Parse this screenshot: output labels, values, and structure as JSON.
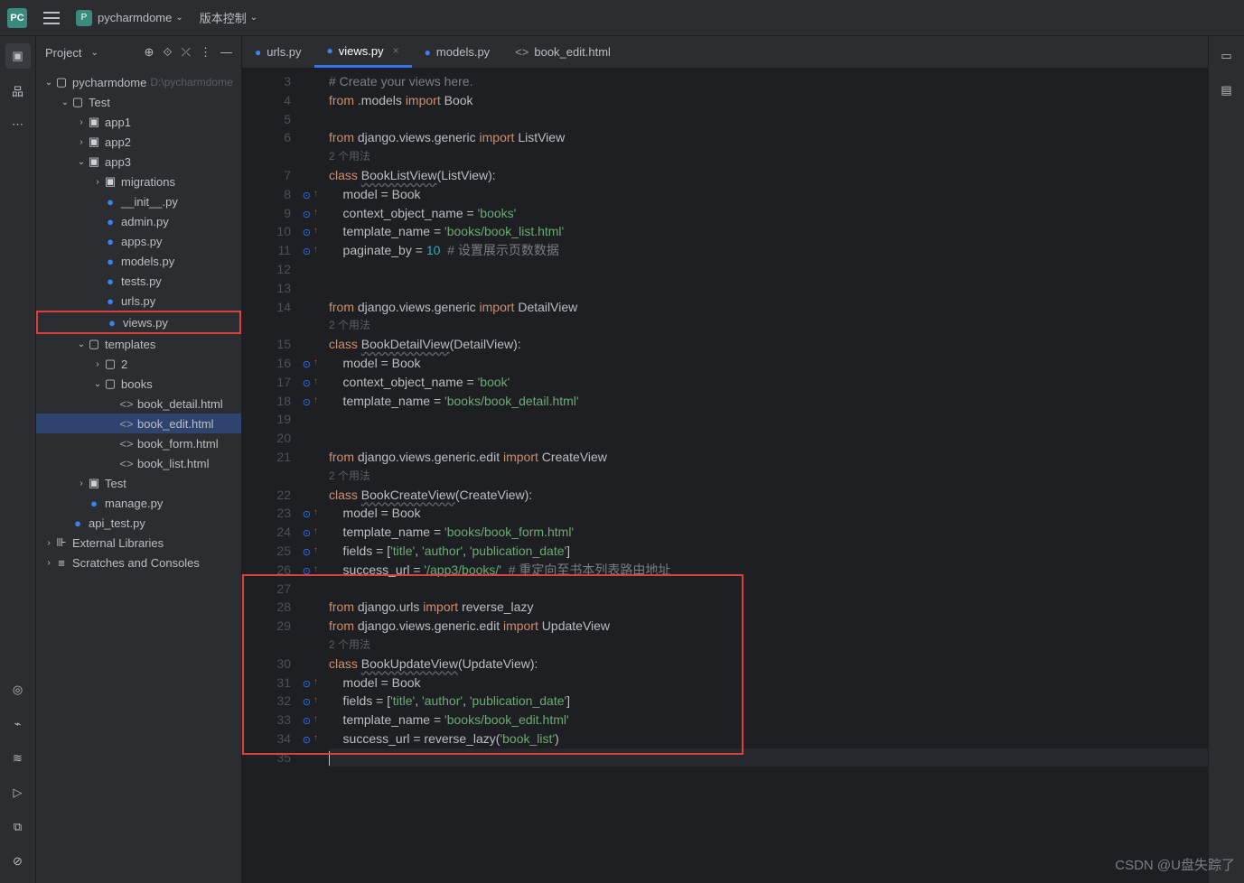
{
  "topbar": {
    "projectName": "pycharmdome",
    "vcs": "版本控制"
  },
  "projectPanel": {
    "title": "Project"
  },
  "tree": {
    "root": {
      "name": "pycharmdome",
      "path": "D:\\pycharmdome"
    },
    "test": "Test",
    "apps": [
      "app1",
      "app2",
      "app3"
    ],
    "app3": {
      "migrations": "migrations",
      "files": [
        "__init__.py",
        "admin.py",
        "apps.py",
        "models.py",
        "tests.py",
        "urls.py",
        "views.py"
      ]
    },
    "templates": "templates",
    "two": "2",
    "books": "books",
    "bookFiles": [
      "book_detail.html",
      "book_edit.html",
      "book_form.html",
      "book_list.html"
    ],
    "testDir": "Test",
    "manage": "manage.py",
    "apiTest": "api_test.py",
    "ext": "External Libraries",
    "scratch": "Scratches and Consoles"
  },
  "tabs": [
    {
      "label": "urls.py",
      "type": "py",
      "active": false
    },
    {
      "label": "views.py",
      "type": "py",
      "active": true,
      "closable": true
    },
    {
      "label": "models.py",
      "type": "py",
      "active": false
    },
    {
      "label": "book_edit.html",
      "type": "html",
      "active": false
    }
  ],
  "usage": "2 个用法",
  "code": {
    "l3": "# Create your views here.",
    "l4a": "from",
    "l4b": " .models ",
    "l4c": "import",
    "l4d": " Book",
    "l6a": "from",
    "l6b": " django.views.generic ",
    "l6c": "import",
    "l6d": " ListView",
    "l7a": "class ",
    "l7b": "BookListView",
    "l7c": "(ListView):",
    "l8": "    model = Book",
    "l9a": "    context_object_name = ",
    "l9b": "'books'",
    "l10a": "    template_name = ",
    "l10b": "'books/book_list.html'",
    "l11a": "    paginate_by = ",
    "l11b": "10",
    "l11c": "  # 设置展示页数数据",
    "l14a": "from",
    "l14b": " django.views.generic ",
    "l14c": "import",
    "l14d": " DetailView",
    "l15a": "class ",
    "l15b": "BookDetailView",
    "l15c": "(DetailView):",
    "l16": "    model = Book",
    "l17a": "    context_object_name = ",
    "l17b": "'book'",
    "l18a": "    template_name = ",
    "l18b": "'books/book_detail.html'",
    "l21a": "from",
    "l21b": " django.views.generic.edit ",
    "l21c": "import",
    "l21d": " CreateView",
    "l22a": "class ",
    "l22b": "BookCreateView",
    "l22c": "(CreateView):",
    "l23": "    model = Book",
    "l24a": "    template_name = ",
    "l24b": "'books/book_form.html'",
    "l25a": "    fields = [",
    "l25b": "'title'",
    "l25c": ", ",
    "l25d": "'author'",
    "l25e": ", ",
    "l25f": "'publication_date'",
    "l25g": "]",
    "l26a": "    success_url = ",
    "l26b": "'/app3/books/'",
    "l26c": "  # 重定向至书本列表路由地址",
    "l28a": "from",
    "l28b": " django.urls ",
    "l28c": "import",
    "l28d": " reverse_lazy",
    "l29a": "from",
    "l29b": " django.views.generic.edit ",
    "l29c": "import",
    "l29d": " UpdateView",
    "l30a": "class ",
    "l30b": "BookUpdateView",
    "l30c": "(UpdateView):",
    "l31": "    model = Book",
    "l32a": "    fields = [",
    "l32b": "'title'",
    "l32c": ", ",
    "l32d": "'author'",
    "l32e": ", ",
    "l32f": "'publication_date'",
    "l32g": "]",
    "l33a": "    template_name = ",
    "l33b": "'books/book_edit.html'",
    "l34a": "    success_url = reverse_lazy(",
    "l34b": "'book_list'",
    "l34c": ")"
  },
  "watermark": "CSDN @U盘失踪了"
}
